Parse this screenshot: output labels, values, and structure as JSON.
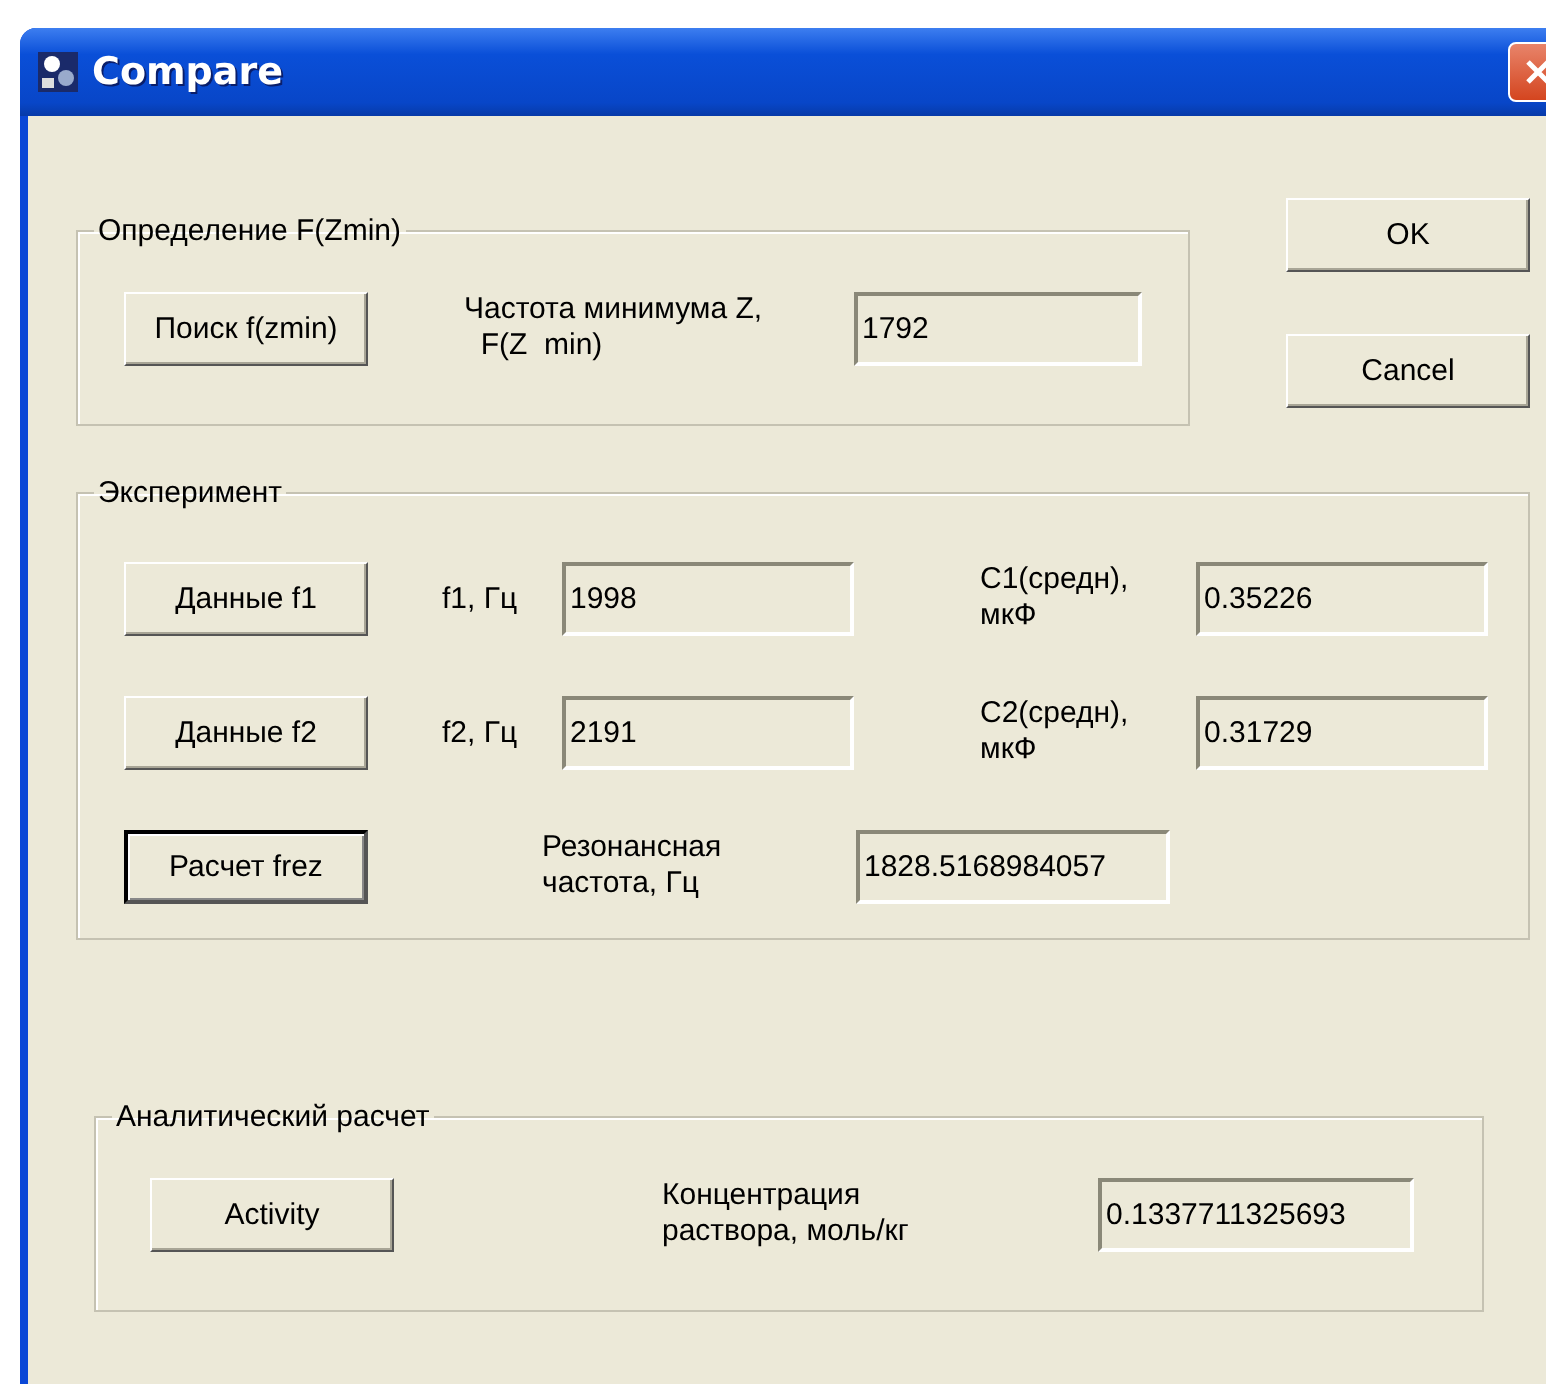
{
  "window": {
    "title": "Compare"
  },
  "search_group": {
    "legend": "Определение F(Zmin)",
    "button": {
      "label": "Поиск f(zmin)",
      "default": false
    },
    "label": [
      "Частота минимума Z,",
      "  F(Z  min)"
    ],
    "field": {
      "value": "1792"
    }
  },
  "dialog_buttons": [
    {
      "label": "OK",
      "default": false
    },
    {
      "label": "Cancel",
      "default": false
    }
  ],
  "experiment": {
    "legend": "Эксперимент",
    "rows": [
      {
        "kind": "data",
        "button": {
          "label": "Данные f1",
          "default": false
        },
        "freq_label": "f1, Гц",
        "freq_value": "1998",
        "cap_label": [
          "C1(средн),",
          "мкФ"
        ],
        "cap_value": "0.35226"
      },
      {
        "kind": "data",
        "button": {
          "label": "Данные f2",
          "default": false
        },
        "freq_label": "f2, Гц",
        "freq_value": "2191",
        "cap_label": [
          "C2(средн),",
          "мкФ"
        ],
        "cap_value": "0.31729"
      },
      {
        "kind": "result",
        "button": {
          "label": "Расчет frez",
          "default": true
        },
        "label": [
          "Резонансная",
          "частота, Гц"
        ],
        "value": "1828.5168984057"
      }
    ]
  },
  "analytic": {
    "legend": "Аналитический расчет",
    "button": {
      "label": "Activity",
      "default": false
    },
    "label": [
      "Концентрация",
      "раствора, моль/кг"
    ],
    "field": {
      "value": "0.1337711325693"
    }
  }
}
